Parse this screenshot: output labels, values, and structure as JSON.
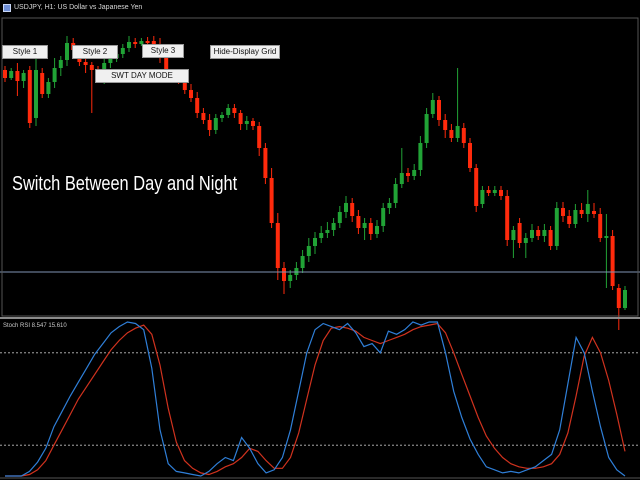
{
  "window": {
    "title": "USDJPY, H1: US Dollar vs Japanese Yen"
  },
  "buttons": {
    "style1": "Style 1",
    "style2": "Style 2",
    "style3": "Style 3",
    "hide_grid": "Hide-Display Grid",
    "swt_day": "SWT DAY MODE"
  },
  "caption": "Switch Between Day and Night",
  "indicator": {
    "title": "Stoch RSI 8.547 15.610",
    "levels": [
      80,
      20
    ],
    "range": [
      0,
      100
    ]
  },
  "colors": {
    "background": "#000000",
    "bull_candle": "#21a336",
    "bear_candle": "#ff2a0c",
    "price_line": "#7f95b3",
    "stoch_main": "#2f7fd8",
    "stoch_signal": "#d0321e",
    "level_line": "#bfbfbf"
  },
  "chart_data": {
    "type": "line",
    "price_line_label": "",
    "candles": [
      {
        "o": 52,
        "c": 60,
        "h": 48,
        "l": 64
      },
      {
        "o": 60,
        "c": 53,
        "h": 50,
        "l": 62
      },
      {
        "o": 53,
        "c": 63,
        "h": 45,
        "l": 78
      },
      {
        "o": 63,
        "c": 55,
        "h": 52,
        "l": 70
      },
      {
        "o": 52,
        "c": 105,
        "h": 48,
        "l": 110
      },
      {
        "o": 100,
        "c": 52,
        "h": 40,
        "l": 108
      },
      {
        "o": 55,
        "c": 76,
        "h": 50,
        "l": 80
      },
      {
        "o": 76,
        "c": 64,
        "h": 60,
        "l": 80
      },
      {
        "o": 64,
        "c": 50,
        "h": 40,
        "l": 70
      },
      {
        "o": 50,
        "c": 42,
        "h": 38,
        "l": 58
      },
      {
        "o": 42,
        "c": 25,
        "h": 18,
        "l": 48
      },
      {
        "o": 25,
        "c": 32,
        "h": 20,
        "l": 38
      },
      {
        "o": 32,
        "c": 44,
        "h": 28,
        "l": 48
      },
      {
        "o": 44,
        "c": 47,
        "h": 40,
        "l": 55
      },
      {
        "o": 47,
        "c": 52,
        "h": 44,
        "l": 95
      },
      {
        "o": 52,
        "c": 60,
        "h": 48,
        "l": 64
      },
      {
        "o": 60,
        "c": 45,
        "h": 40,
        "l": 66
      },
      {
        "o": 45,
        "c": 40,
        "h": 36,
        "l": 50
      },
      {
        "o": 40,
        "c": 36,
        "h": 32,
        "l": 44
      },
      {
        "o": 36,
        "c": 30,
        "h": 26,
        "l": 40
      },
      {
        "o": 30,
        "c": 24,
        "h": 18,
        "l": 34
      },
      {
        "o": 24,
        "c": 26,
        "h": 20,
        "l": 30
      },
      {
        "o": 26,
        "c": 23,
        "h": 20,
        "l": 28
      },
      {
        "o": 23,
        "c": 23,
        "h": 19,
        "l": 28
      },
      {
        "o": 23,
        "c": 26,
        "h": 18,
        "l": 30
      },
      {
        "o": 26,
        "c": 40,
        "h": 20,
        "l": 45
      },
      {
        "o": 40,
        "c": 58,
        "h": 35,
        "l": 62
      },
      {
        "o": 58,
        "c": 60,
        "h": 55,
        "l": 64
      },
      {
        "o": 60,
        "c": 62,
        "h": 56,
        "l": 66
      },
      {
        "o": 62,
        "c": 72,
        "h": 58,
        "l": 76
      },
      {
        "o": 72,
        "c": 80,
        "h": 66,
        "l": 84
      },
      {
        "o": 80,
        "c": 95,
        "h": 74,
        "l": 100
      },
      {
        "o": 95,
        "c": 102,
        "h": 90,
        "l": 106
      },
      {
        "o": 102,
        "c": 112,
        "h": 96,
        "l": 118
      },
      {
        "o": 112,
        "c": 100,
        "h": 96,
        "l": 116
      },
      {
        "o": 100,
        "c": 97,
        "h": 94,
        "l": 104
      },
      {
        "o": 97,
        "c": 90,
        "h": 86,
        "l": 100
      },
      {
        "o": 90,
        "c": 95,
        "h": 86,
        "l": 100
      },
      {
        "o": 95,
        "c": 106,
        "h": 92,
        "l": 112
      },
      {
        "o": 106,
        "c": 103,
        "h": 98,
        "l": 112
      },
      {
        "o": 103,
        "c": 108,
        "h": 100,
        "l": 112
      },
      {
        "o": 108,
        "c": 130,
        "h": 104,
        "l": 138
      },
      {
        "o": 130,
        "c": 160,
        "h": 125,
        "l": 166
      },
      {
        "o": 160,
        "c": 205,
        "h": 150,
        "l": 210
      },
      {
        "o": 205,
        "c": 250,
        "h": 195,
        "l": 262
      },
      {
        "o": 250,
        "c": 263,
        "h": 244,
        "l": 276
      },
      {
        "o": 263,
        "c": 257,
        "h": 252,
        "l": 270
      },
      {
        "o": 257,
        "c": 250,
        "h": 244,
        "l": 262
      },
      {
        "o": 250,
        "c": 238,
        "h": 232,
        "l": 255
      },
      {
        "o": 238,
        "c": 228,
        "h": 220,
        "l": 244
      },
      {
        "o": 228,
        "c": 220,
        "h": 214,
        "l": 236
      },
      {
        "o": 220,
        "c": 215,
        "h": 208,
        "l": 225
      },
      {
        "o": 215,
        "c": 212,
        "h": 204,
        "l": 220
      },
      {
        "o": 212,
        "c": 205,
        "h": 200,
        "l": 218
      },
      {
        "o": 205,
        "c": 194,
        "h": 188,
        "l": 210
      },
      {
        "o": 194,
        "c": 185,
        "h": 178,
        "l": 200
      },
      {
        "o": 185,
        "c": 198,
        "h": 180,
        "l": 204
      },
      {
        "o": 198,
        "c": 210,
        "h": 192,
        "l": 216
      },
      {
        "o": 210,
        "c": 205,
        "h": 200,
        "l": 222
      },
      {
        "o": 205,
        "c": 216,
        "h": 200,
        "l": 222
      },
      {
        "o": 216,
        "c": 208,
        "h": 202,
        "l": 220
      },
      {
        "o": 208,
        "c": 190,
        "h": 185,
        "l": 214
      },
      {
        "o": 190,
        "c": 185,
        "h": 180,
        "l": 196
      },
      {
        "o": 185,
        "c": 166,
        "h": 160,
        "l": 190
      },
      {
        "o": 166,
        "c": 155,
        "h": 130,
        "l": 170
      },
      {
        "o": 155,
        "c": 158,
        "h": 150,
        "l": 164
      },
      {
        "o": 158,
        "c": 152,
        "h": 146,
        "l": 162
      },
      {
        "o": 152,
        "c": 125,
        "h": 118,
        "l": 158
      },
      {
        "o": 125,
        "c": 96,
        "h": 90,
        "l": 130
      },
      {
        "o": 96,
        "c": 82,
        "h": 75,
        "l": 100
      },
      {
        "o": 82,
        "c": 102,
        "h": 78,
        "l": 108
      },
      {
        "o": 102,
        "c": 112,
        "h": 96,
        "l": 120
      },
      {
        "o": 112,
        "c": 120,
        "h": 106,
        "l": 124
      },
      {
        "o": 120,
        "c": 108,
        "h": 50,
        "l": 124
      },
      {
        "o": 110,
        "c": 125,
        "h": 105,
        "l": 130
      },
      {
        "o": 125,
        "c": 150,
        "h": 120,
        "l": 154
      },
      {
        "o": 150,
        "c": 188,
        "h": 146,
        "l": 194
      },
      {
        "o": 186,
        "c": 172,
        "h": 168,
        "l": 190
      },
      {
        "o": 172,
        "c": 175,
        "h": 168,
        "l": 178
      },
      {
        "o": 175,
        "c": 172,
        "h": 168,
        "l": 178
      },
      {
        "o": 172,
        "c": 178,
        "h": 168,
        "l": 182
      },
      {
        "o": 178,
        "c": 222,
        "h": 172,
        "l": 228
      },
      {
        "o": 222,
        "c": 212,
        "h": 208,
        "l": 240
      },
      {
        "o": 205,
        "c": 225,
        "h": 200,
        "l": 230
      },
      {
        "o": 225,
        "c": 220,
        "h": 215,
        "l": 240
      },
      {
        "o": 220,
        "c": 212,
        "h": 206,
        "l": 224
      },
      {
        "o": 212,
        "c": 218,
        "h": 208,
        "l": 222
      },
      {
        "o": 218,
        "c": 212,
        "h": 206,
        "l": 224
      },
      {
        "o": 212,
        "c": 228,
        "h": 208,
        "l": 232
      },
      {
        "o": 228,
        "c": 190,
        "h": 184,
        "l": 232
      },
      {
        "o": 190,
        "c": 198,
        "h": 184,
        "l": 204
      },
      {
        "o": 198,
        "c": 206,
        "h": 192,
        "l": 210
      },
      {
        "o": 206,
        "c": 192,
        "h": 186,
        "l": 210
      },
      {
        "o": 192,
        "c": 196,
        "h": 185,
        "l": 200
      },
      {
        "o": 196,
        "c": 186,
        "h": 172,
        "l": 204
      },
      {
        "o": 193,
        "c": 196,
        "h": 185,
        "l": 200
      },
      {
        "o": 196,
        "c": 220,
        "h": 190,
        "l": 224
      },
      {
        "o": 220,
        "c": 218,
        "h": 196,
        "l": 270
      },
      {
        "o": 218,
        "c": 268,
        "h": 212,
        "l": 272
      },
      {
        "o": 270,
        "c": 290,
        "h": 266,
        "l": 312
      },
      {
        "o": 290,
        "c": 272,
        "h": 268,
        "l": 292
      }
    ],
    "stoch_main": [
      0,
      0,
      0,
      3,
      9,
      18,
      32,
      42,
      52,
      61,
      70,
      79,
      86,
      93,
      97,
      100,
      99,
      95,
      70,
      30,
      8,
      3,
      2,
      1,
      0,
      3,
      8,
      12,
      10,
      25,
      18,
      8,
      2,
      4,
      12,
      30,
      55,
      80,
      95,
      99,
      97,
      95,
      99,
      93,
      84,
      86,
      80,
      94,
      92,
      95,
      100,
      98,
      100,
      100,
      80,
      55,
      38,
      24,
      14,
      6,
      4,
      2,
      3,
      2,
      4,
      6,
      10,
      14,
      30,
      60,
      90,
      80,
      55,
      32,
      12,
      4,
      0
    ],
    "stoch_signal": [
      0,
      0,
      0,
      1,
      4,
      10,
      20,
      30,
      40,
      50,
      58,
      66,
      74,
      82,
      88,
      93,
      96,
      98,
      92,
      72,
      44,
      22,
      10,
      5,
      2,
      1,
      3,
      6,
      8,
      12,
      18,
      16,
      10,
      5,
      5,
      12,
      28,
      50,
      72,
      88,
      96,
      97,
      96,
      94,
      90,
      88,
      86,
      88,
      90,
      92,
      95,
      97,
      98,
      99,
      93,
      80,
      66,
      52,
      38,
      26,
      18,
      12,
      8,
      6,
      5,
      5,
      6,
      8,
      14,
      28,
      52,
      78,
      90,
      80,
      62,
      40,
      16
    ]
  }
}
